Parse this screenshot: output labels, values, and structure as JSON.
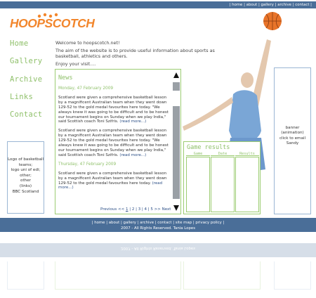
{
  "topnav": {
    "sep": "|",
    "items": [
      "home",
      "about",
      "gallery",
      "archive",
      "contact"
    ]
  },
  "logo": {
    "text": "HOOPSCOTCH"
  },
  "leftnav": [
    "Home",
    "Gallery",
    "Archive",
    "Links",
    "Contact"
  ],
  "welcome": {
    "line1": "Welcome to hoopscotch.net!",
    "line2": "The aim of the website is to provide useful information about sports as basketball, athletics and others.",
    "line3": "Enjoy your visit...."
  },
  "sponsor": {
    "lines": [
      "Logo of basketball",
      "teams;",
      "logo uni of edi;",
      "other;",
      "other",
      "(links)",
      "BBC Scotland"
    ]
  },
  "news": {
    "title": "News",
    "date1": "Monday, 47 February 2009",
    "p1": "Scotland were given a comprehensive basketball lesson by a magnificent Australian team when they went down 129-52 to the gold medal favourites here today.",
    "q1": "\"We always knew it was going to be difficult and to be honest our tournament begins on Sunday when we play India,\" said Scottish coach Toni Szifris.",
    "p2": "Scotland were given a comprehensive basketball lesson by a magnificent Australian team when they went down 129-52 to the gold medal favourites here today.",
    "q2": "\"We always knew it was going to be difficult and to be honest our tournament begins on Sunday when we play India,\" said Scottish coach Toni Szifris.",
    "date2": "Thursday, 47 February 2009",
    "p3": "Scotland were given a comprehensive basketball lesson by a magnificent Australian team when they went down 129-52 to the gold medal favourites here today.",
    "readmore": "(read more...)",
    "pager": {
      "previous": "Previous <<",
      "pages": [
        "1",
        "2",
        "3",
        "4",
        "5"
      ],
      "next": ">> Next",
      "current": "1"
    }
  },
  "gameresults": {
    "title": "Game results",
    "columns": [
      "Game",
      "Date",
      "Results"
    ]
  },
  "banner": {
    "lines": [
      "banner",
      "(animation)",
      "click to email",
      "Sandy"
    ]
  },
  "footer": {
    "nav": [
      "home",
      "about",
      "gallery",
      "archive",
      "contact",
      "site map",
      "privacy policy"
    ],
    "copyright": "2007 - All Rights Reserved. Tania Lopes"
  },
  "colors": {
    "bar": "#4a6e98",
    "accent_green": "#8fc06a",
    "logo_orange": "#f2862c",
    "link_blue": "#2c4f86"
  },
  "icons": [
    "basketball-icon",
    "player-silhouette",
    "scroll-up-arrow-icon",
    "scroll-down-arrow-icon"
  ]
}
